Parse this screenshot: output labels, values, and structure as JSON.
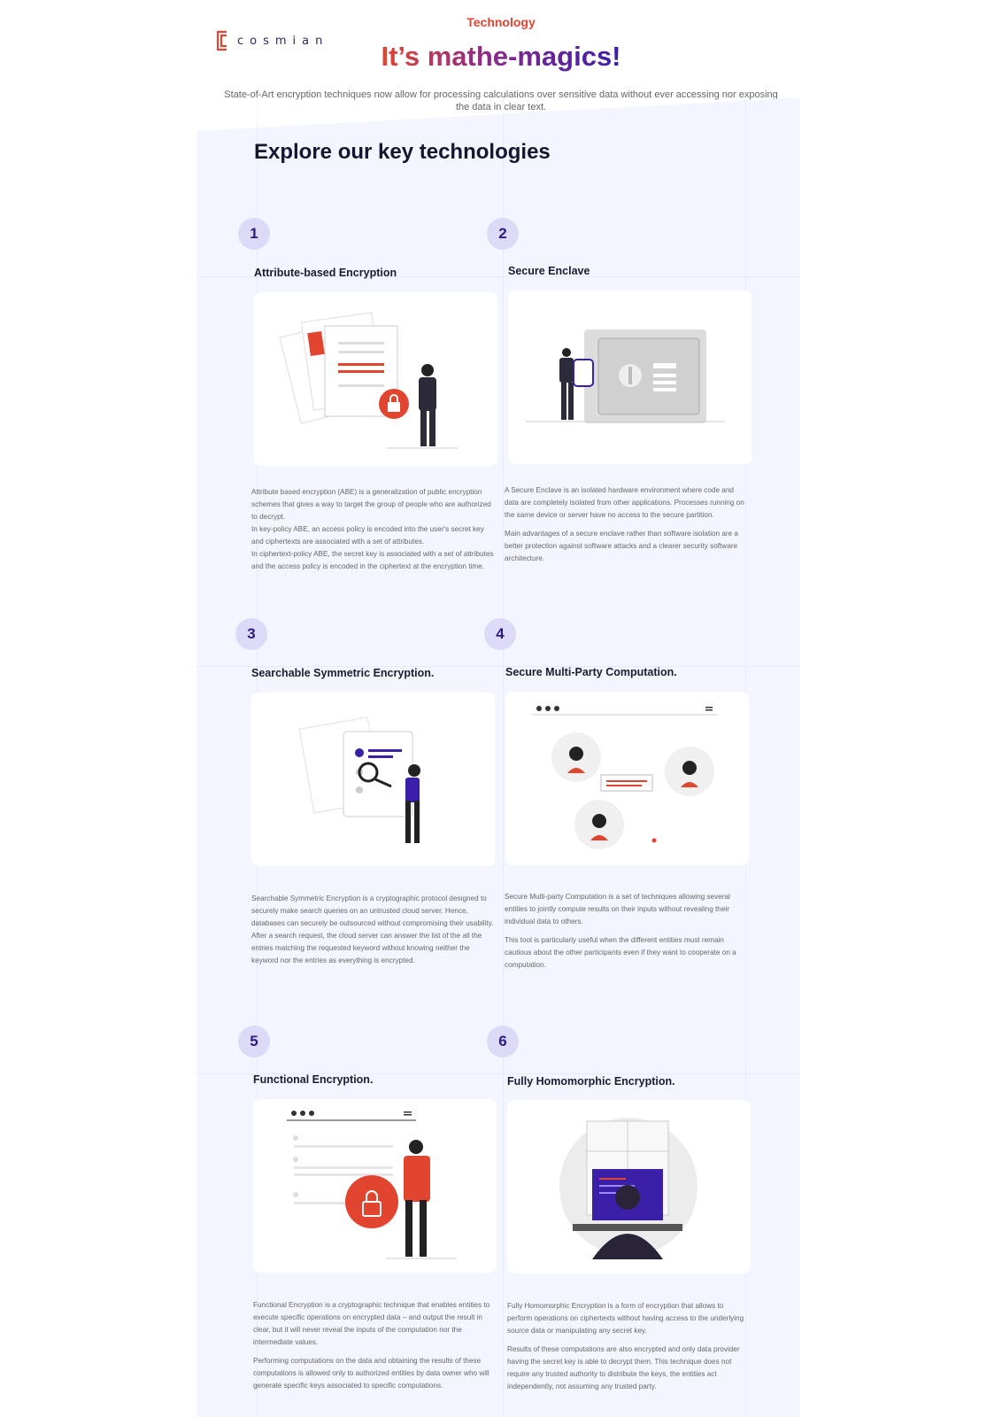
{
  "brand": {
    "name": "cosmian",
    "accent": "#e2452f",
    "secondary": "#3b1fa8"
  },
  "header": {
    "eyebrow": "Technology",
    "title": "It’s mathe-magics!",
    "subtitle": "State-of-Art encryption techniques now allow for processing calculations over sensitive data without ever accessing nor exposing the data in clear text."
  },
  "section_title": "Explore our key technologies",
  "technologies": [
    {
      "number": "1",
      "title": "Attribute-based Encryption",
      "paragraphs": [
        "Attribute based encryption (ABE) is a generalization of  public encryption schemes that gives a way to target the group of people who are authorized to decrypt.\nIn key-policy ABE, an access policy is encoded into the user's secret key and ciphertexts are associated with a set of attributes.\nIn ciphertext-policy ABE, the secret key is associated with a set of attributes and the access policy is encoded in the ciphertext at the encryption time."
      ]
    },
    {
      "number": "2",
      "title": "Secure Enclave",
      "paragraphs": [
        "A Secure Enclave is an isolated hardware environment where code and data are completely isolated from other applications. Processes running on the same device or server have no access to the secure partition.",
        "Main advantages of a secure enclave rather than software isolation are a better protection against software attacks and a clearer security software architecture."
      ]
    },
    {
      "number": "3",
      "title": "Searchable Symmetric Encryption.",
      "paragraphs": [
        "Searchable Symmetric Encryption is a cryptographic protocol designed to securely make search queries on an untrusted cloud server. Hence, databases can securely be outsourced without compromising their usability.\nAfter a search request, the cloud server can answer the list of the all the entries matching the requested keyword without knowing neither the keyword nor the entries as everything is encrypted."
      ]
    },
    {
      "number": "4",
      "title": "Secure Multi-Party Computation.",
      "paragraphs": [
        "Secure Multi-party Computation is a set of techniques allowing several entities to jointly compute results on their inputs without revealing their individual data to others.",
        "This tool is particularly useful when the different entities must remain cautious about the other participants even if they want to cooperate on a computation."
      ]
    },
    {
      "number": "5",
      "title": "Functional Encryption.",
      "paragraphs": [
        "Functional Encryption is a cryptographic technique that enables entities to execute specific operations on encrypted data – and output the result in clear, but it will never reveal the inputs of the computation nor the intermediate values.",
        "Performing computations on the data and obtaining the results of these computations is allowed only to authorized entities by data owner who will generate specific keys associated to specific computations."
      ]
    },
    {
      "number": "6",
      "title": "Fully Homomorphic Encryption.",
      "paragraphs": [
        "Fully Homomorphic Encryption is a form of encryption that allows to perform operations on ciphertexts without having access to the underlying source data or manipulating any secret key.",
        "Results of these computations are also encrypted and only data provider having the secret key is able to decrypt them. This technique does not require any trusted authority to distribute the keys, the entities act independently, not assuming any trusted party."
      ]
    }
  ],
  "illustrations": [
    "document-lock-illustration",
    "safe-vault-illustration",
    "document-search-illustration",
    "multi-party-chat-illustration",
    "browser-lock-illustration",
    "computer-window-illustration"
  ]
}
